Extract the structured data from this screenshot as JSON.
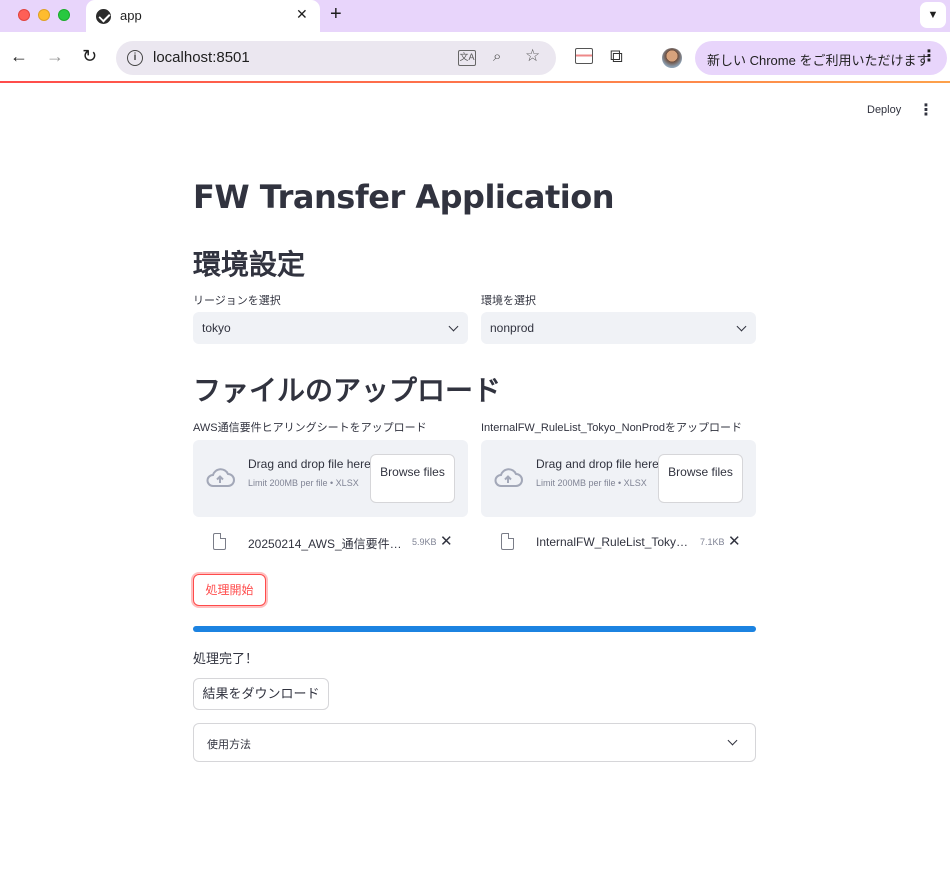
{
  "browser": {
    "tab_title": "app",
    "url": "localhost:8501",
    "chrome_update_label": "新しい Chrome をご利用いただけます"
  },
  "header": {
    "deploy_label": "Deploy"
  },
  "main": {
    "title": "FW Transfer Application",
    "env_heading": "環境設定",
    "region": {
      "label": "リージョンを選択",
      "value": "tokyo"
    },
    "environment": {
      "label": "環境を選択",
      "value": "nonprod"
    },
    "upload_heading": "ファイルのアップロード",
    "uploaders": [
      {
        "label": "AWS通信要件ヒアリングシートをアップロード",
        "drop_text": "Drag and drop file here",
        "limit_text": "Limit 200MB per file • XLSX",
        "browse_label": "Browse files",
        "file_name": "20250214_AWS_通信要件…",
        "file_size": "5.9KB"
      },
      {
        "label": "InternalFW_RuleList_Tokyo_NonProdをアップロード",
        "drop_text": "Drag and drop file here",
        "limit_text": "Limit 200MB per file • XLSX",
        "browse_label": "Browse files",
        "file_name": "InternalFW_RuleList_Toky…",
        "file_size": "7.1KB"
      }
    ],
    "start_button": "処理開始",
    "progress": 1.0,
    "status_text": "処理完了！",
    "download_button": "結果をダウンロード",
    "expander_label": "使用方法"
  },
  "colors": {
    "accent": "#ff4b4b",
    "progress": "#1c83e1",
    "input_bg": "#f0f2f6",
    "text": "#31333f"
  }
}
